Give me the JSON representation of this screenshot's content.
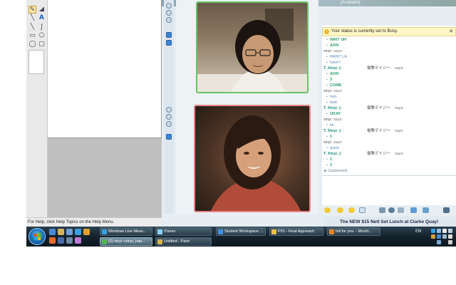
{
  "paint": {
    "status_text": "For Help, click Help Topics on the Help Menu.",
    "tools": [
      "pencil-tool",
      "fill-tool",
      "brush-tool",
      "text-tool",
      "line-tool",
      "curve-tool",
      "rectangle-tool",
      "polygon-tool",
      "ellipse-tool",
      "rounded-rect-tool"
    ]
  },
  "msn": {
    "status": "[Available]",
    "notice": "Your status is currently set to Busy.",
    "notice_close": "✕",
    "ad": "The NEW $15 Nett Set Lunch at Clarke Quay!",
    "chat": [
      {
        "kind": "msg-t",
        "text": "WAIT UH"
      },
      {
        "kind": "msg-t",
        "text": "AON"
      },
      {
        "kind": "sender-x",
        "text": "xinyi"
      },
      {
        "kind": "msg-x",
        "text": "PAINT LA"
      },
      {
        "kind": "msg-x",
        "text": "have?"
      },
      {
        "kind": "sender-t",
        "text": "T. Xinyi. (:"
      },
      {
        "kind": "msg-t",
        "text": "AON"
      },
      {
        "kind": "msg-t",
        "text": "3"
      },
      {
        "kind": "msg-t",
        "text": "COME"
      },
      {
        "kind": "sender-x",
        "text": "xinyi"
      },
      {
        "kind": "msg-x",
        "text": "huh."
      },
      {
        "kind": "msg-x",
        "text": "wait."
      },
      {
        "kind": "sender-t",
        "text": "T. Xinyi. (:"
      },
      {
        "kind": "msg-t",
        "text": "OKAY"
      },
      {
        "kind": "sender-x",
        "text": "xinyi"
      },
      {
        "kind": "msg-x",
        "text": "kk"
      },
      {
        "kind": "sender-t",
        "text": "T. Xinyi. (:"
      },
      {
        "kind": "msg-t",
        "text": "1"
      },
      {
        "kind": "sender-x",
        "text": "xinyi"
      },
      {
        "kind": "msg-x",
        "text": "quick"
      },
      {
        "kind": "sender-t",
        "text": "T. Xinyi. (:"
      },
      {
        "kind": "msg-t",
        "text": "2"
      },
      {
        "kind": "msg-t",
        "text": "3"
      },
      {
        "kind": "connected",
        "text": "Connected."
      }
    ],
    "says_word": "says:",
    "alias_right": "電撃デイジー",
    "colors": {
      "remote_border": "#69c567",
      "local_border": "#e7868a"
    }
  },
  "taskbar": {
    "row1": [
      {
        "label": "Windows Live Mess...",
        "icon": "messenger-icon",
        "color": "#3aa0e0",
        "active": false
      },
      {
        "label": "iTunes",
        "icon": "itunes-icon",
        "color": "#8fd0ff",
        "active": false
      },
      {
        "label": "Student Workspace ...",
        "icon": "ie-icon",
        "color": "#3f8fe0",
        "active": false
      },
      {
        "label": "P01 - Final Approach",
        "icon": "word-icon",
        "color": "#e8c24a",
        "active": false
      },
      {
        "label": "fall for you. - Mozill...",
        "icon": "firefox-icon",
        "color": "#e8862a",
        "active": false
      }
    ],
    "row2": [
      {
        "label": "(2) xinyi <xinyi_hap...",
        "icon": "messenger-icon",
        "color": "#52b852",
        "active": true
      },
      {
        "label": "Untitled - Paint",
        "icon": "paint-icon",
        "color": "#d8b44a",
        "active": false
      }
    ],
    "lang": "EN"
  }
}
